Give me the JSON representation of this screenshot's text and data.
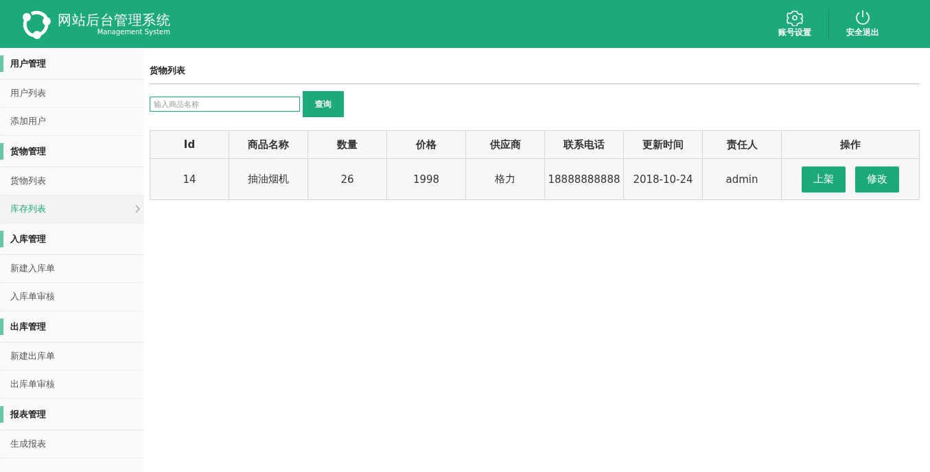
{
  "header": {
    "title": "网站后台管理系统",
    "subtitle": "Management System",
    "actions": [
      {
        "kind": "settings",
        "label": "账号设置"
      },
      {
        "kind": "power",
        "label": "安全退出"
      }
    ]
  },
  "sidebar": {
    "groups": [
      {
        "title": "用户管理",
        "items": [
          {
            "label": "用户列表",
            "selected": false
          },
          {
            "label": "添加用户",
            "selected": false
          }
        ]
      },
      {
        "title": "货物管理",
        "items": [
          {
            "label": "货物列表",
            "selected": false
          },
          {
            "label": "库存列表",
            "selected": true
          }
        ]
      },
      {
        "title": "入库管理",
        "items": [
          {
            "label": "新建入库单",
            "selected": false
          },
          {
            "label": "入库单审核",
            "selected": false
          }
        ]
      },
      {
        "title": "出库管理",
        "items": [
          {
            "label": "新建出库单",
            "selected": false
          },
          {
            "label": "出库单审核",
            "selected": false
          }
        ]
      },
      {
        "title": "报表管理",
        "items": [
          {
            "label": "生成报表",
            "selected": false
          }
        ]
      }
    ]
  },
  "main": {
    "title": "货物列表",
    "search": {
      "placeholder": "输入商品名称",
      "button": "查询"
    },
    "table": {
      "columns": [
        "Id",
        "商品名称",
        "数量",
        "价格",
        "供应商",
        "联系电话",
        "更新时间",
        "责任人",
        "操作"
      ],
      "rows": [
        {
          "cells": [
            "14",
            "抽油烟机",
            "26",
            "1998",
            "格力",
            "18888888888",
            "2018-10-24",
            "admin"
          ],
          "actions": [
            "上架",
            "修改"
          ]
        }
      ]
    }
  }
}
